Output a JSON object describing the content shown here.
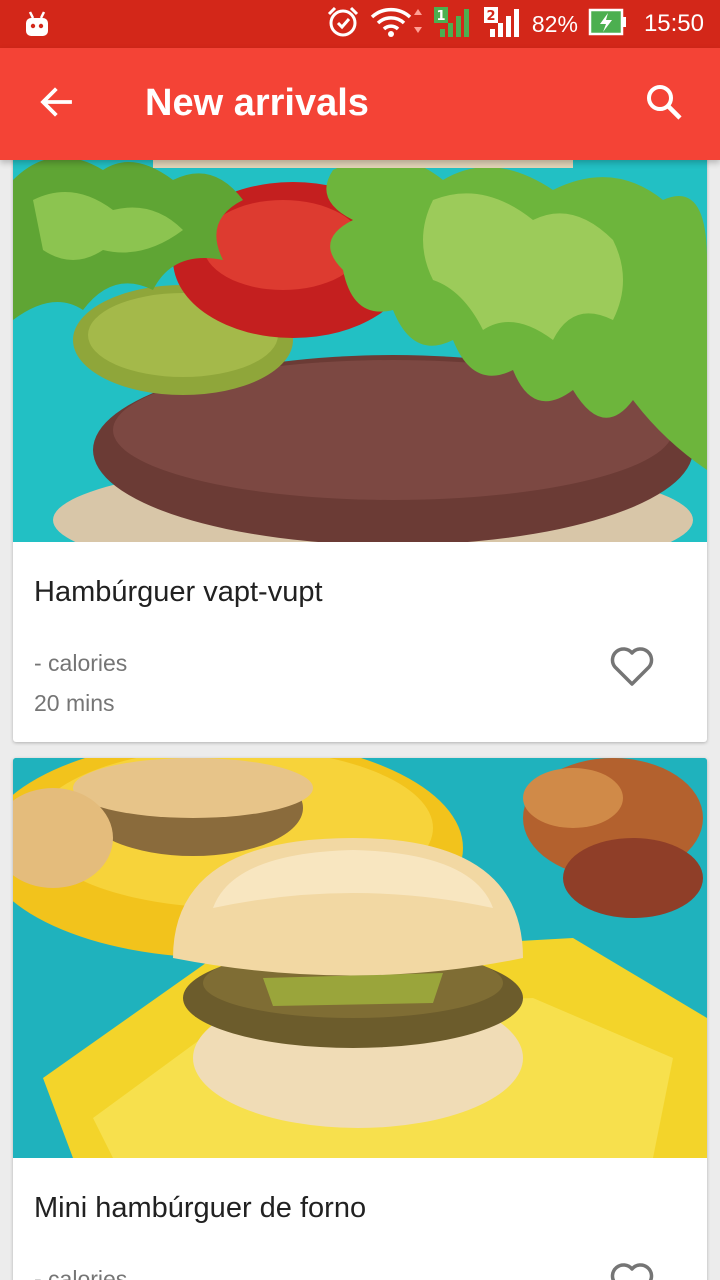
{
  "status_bar": {
    "battery": "82%",
    "time": "15:50",
    "sim1": "1",
    "sim2": "2"
  },
  "app_bar": {
    "title": "New arrivals",
    "back_icon": "arrow-back-icon",
    "search_icon": "search-icon"
  },
  "colors": {
    "status_bar": "#d32719",
    "app_bar": "#f44336",
    "background": "#ececec"
  },
  "recipes": [
    {
      "title": "Hambúrguer vapt-vupt",
      "calories": "- calories",
      "time": "20 mins",
      "favorite_icon": "heart-outline-icon"
    },
    {
      "title": "Mini hambúrguer de forno",
      "calories": "- calories",
      "favorite_icon": "heart-outline-icon"
    }
  ]
}
